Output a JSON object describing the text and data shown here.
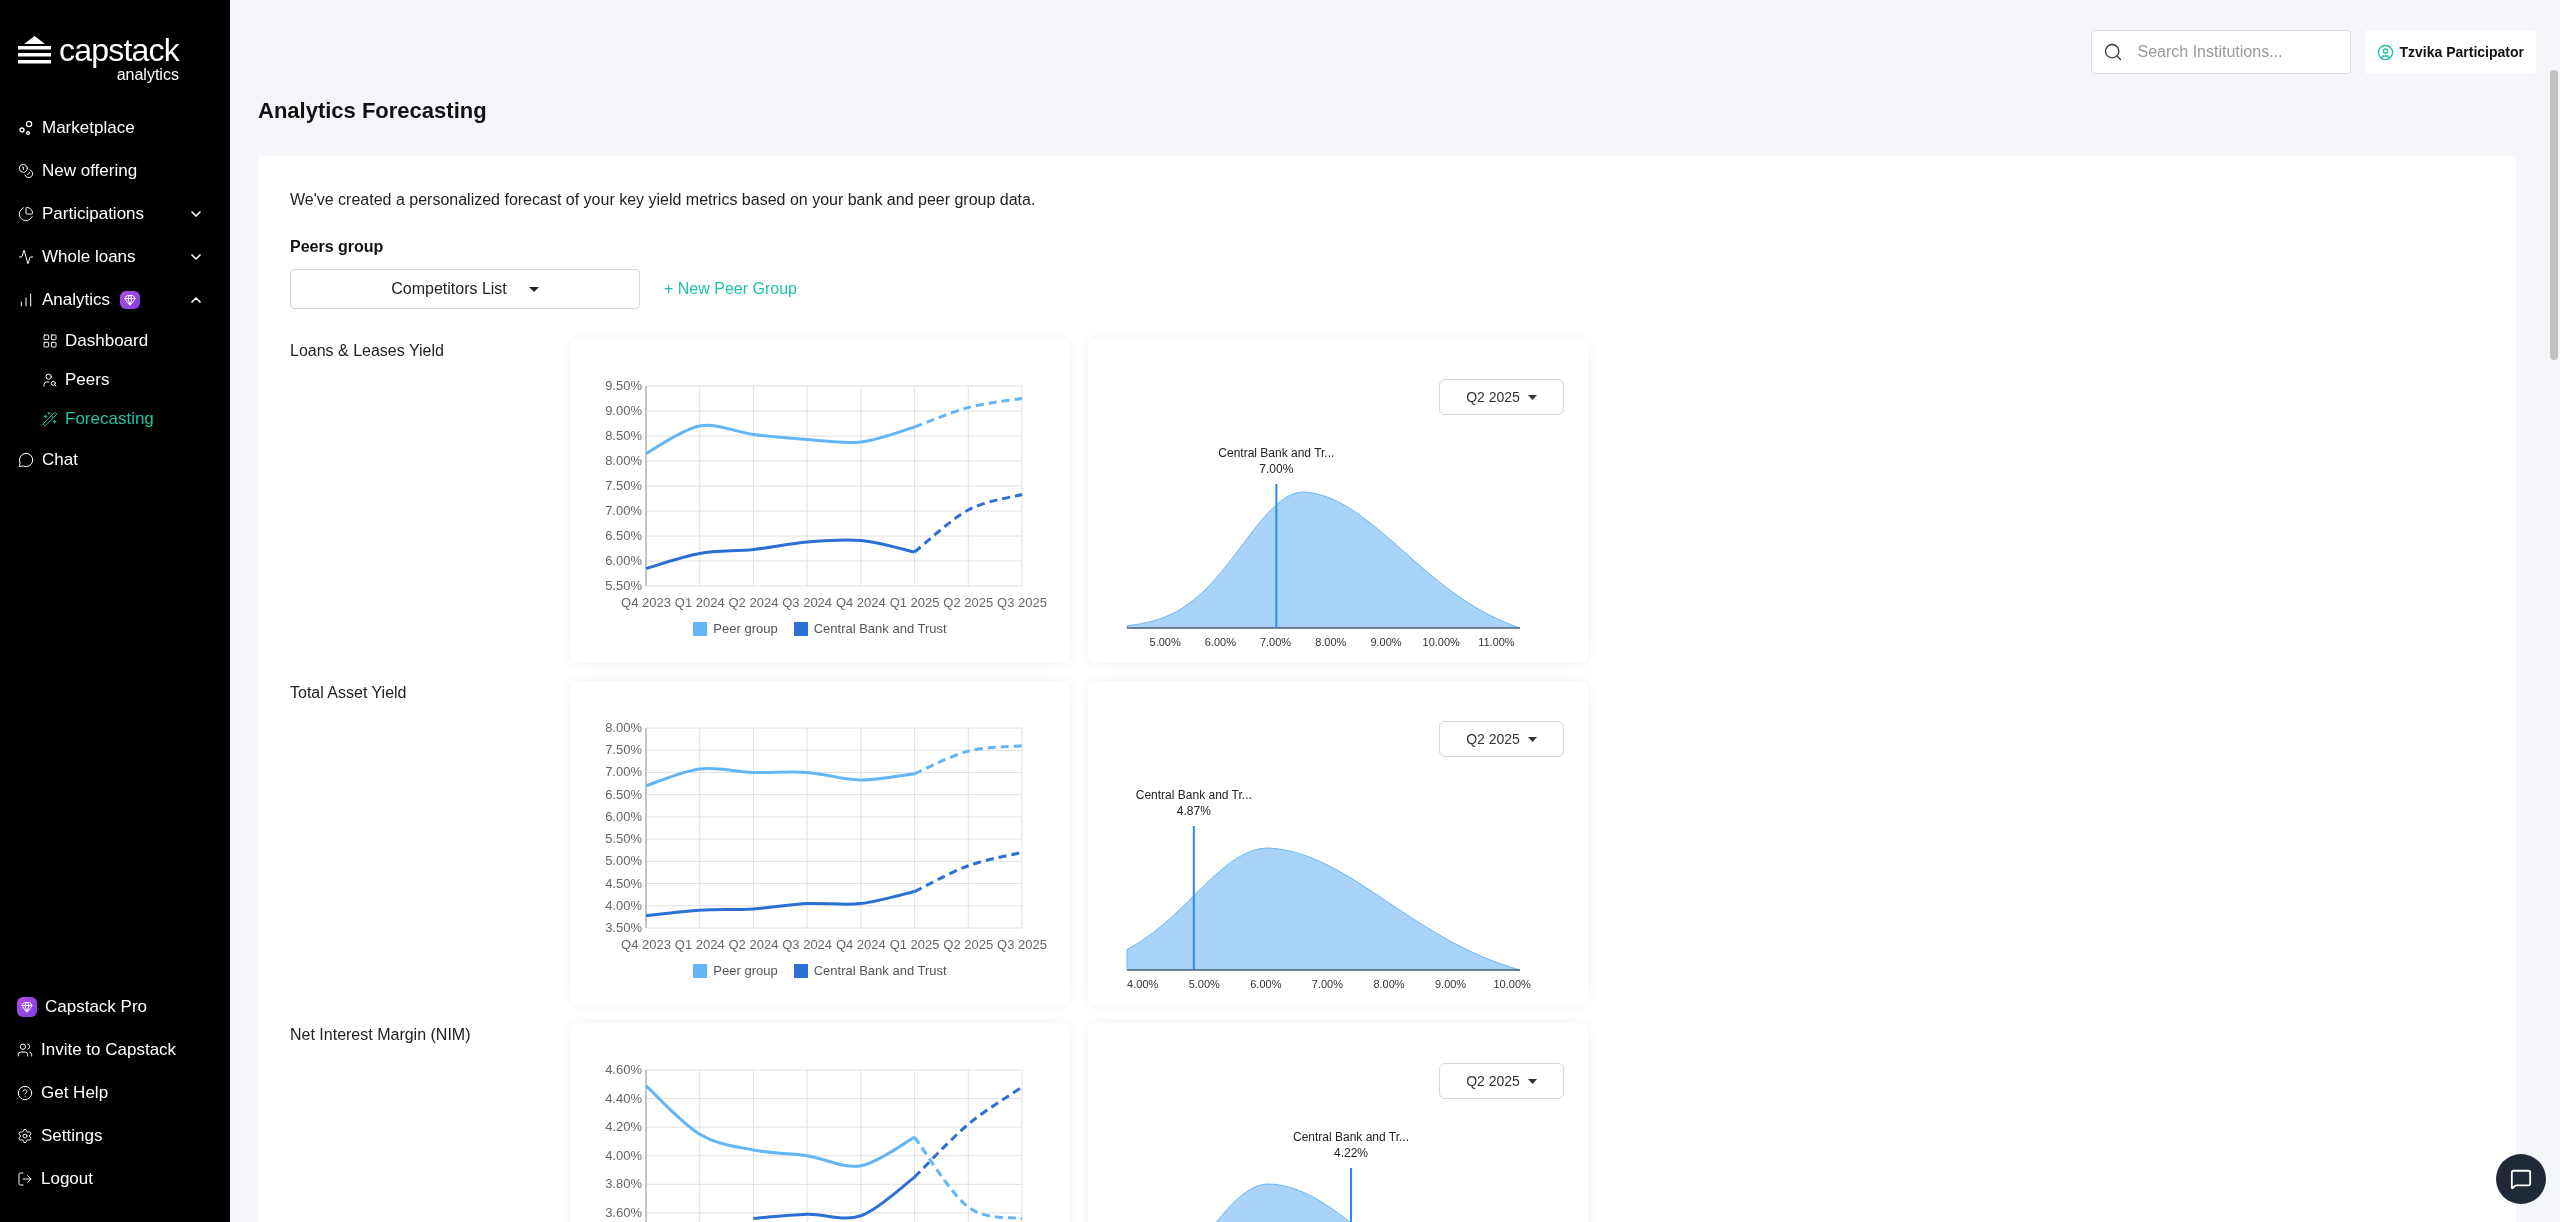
{
  "sidebar": {
    "logo": {
      "name": "capstack",
      "tagline": "analytics"
    },
    "items": [
      {
        "label": "Marketplace",
        "selected": false
      },
      {
        "label": "New offering",
        "selected": false
      },
      {
        "label": "Participations",
        "selected": false,
        "expanded": false
      },
      {
        "label": "Whole loans",
        "selected": false,
        "expanded": false
      },
      {
        "label": "Analytics",
        "selected": false,
        "expanded": true,
        "pro_badge": true,
        "children": [
          {
            "label": "Dashboard",
            "selected": false
          },
          {
            "label": "Peers",
            "selected": false
          },
          {
            "label": "Forecasting",
            "selected": true
          }
        ]
      },
      {
        "label": "Chat",
        "selected": false
      }
    ],
    "bottom_items": [
      {
        "label": "Capstack Pro",
        "kind": "pro"
      },
      {
        "label": "Invite to Capstack",
        "kind": "link"
      },
      {
        "label": "Get Help",
        "kind": "link"
      },
      {
        "label": "Settings",
        "kind": "link"
      },
      {
        "label": "Logout",
        "kind": "link"
      }
    ]
  },
  "topbar": {
    "search": {
      "placeholder": "Search Institutions..."
    },
    "user": {
      "name": "Tzvika Participator"
    }
  },
  "page": {
    "title": "Analytics Forecasting",
    "intro": "We've created a personalized forecast of your key yield metrics based on your bank and peer group data.",
    "peers_group": {
      "label": "Peers group",
      "select": {
        "value": "Competitors List"
      },
      "new_link": "+ New Peer Group"
    }
  },
  "metrics": [
    {
      "title": "Loans & Leases Yield",
      "trend": {
        "chart_data": {
          "type": "line",
          "categories": [
            "Q4 2023",
            "Q1 2024",
            "Q2 2024",
            "Q3 2024",
            "Q4 2024",
            "Q1 2025",
            "Q2 2025",
            "Q3 2025"
          ],
          "ylim": [
            5.5,
            9.5
          ],
          "yticks": [
            {
              "value": 5.5,
              "label": "5.50%"
            },
            {
              "value": 6,
              "label": "6.00%"
            },
            {
              "value": 6.5,
              "label": "6.50%"
            },
            {
              "value": 7,
              "label": "7.00%"
            },
            {
              "value": 7.5,
              "label": "7.50%"
            },
            {
              "value": 8,
              "label": "8.00%"
            },
            {
              "value": 8.5,
              "label": "8.50%"
            },
            {
              "value": 9,
              "label": "9.00%"
            },
            {
              "value": 9.5,
              "label": "9.50%"
            }
          ],
          "grid": true,
          "legend": "bottom",
          "series": [
            {
              "name": "Peer group",
              "color": "#64b5f6",
              "values": [
                8.15,
                8.7,
                8.53,
                8.43,
                8.38,
                8.68,
                null,
                null
              ]
            },
            {
              "name": "Central Bank and Trust",
              "color": "#2a70d4",
              "values": [
                5.85,
                6.15,
                6.23,
                6.38,
                6.41,
                6.18,
                null,
                null
              ]
            },
            {
              "color": "#64b5f6",
              "line_style": "dashed",
              "values": [
                null,
                null,
                null,
                null,
                null,
                8.68,
                9.07,
                9.25
              ]
            },
            {
              "color": "#2a70d4",
              "line_style": "dashed",
              "values": [
                null,
                null,
                null,
                null,
                null,
                6.18,
                7.02,
                7.33
              ]
            }
          ]
        }
      },
      "distribution": {
        "period": "Q2 2025",
        "marker_label": "Central Bank and Tr...",
        "marker_value": "7.00%",
        "x_axis_labels": [
          "5.00%",
          "6.00%",
          "7.00%",
          "8.00%",
          "9.00%",
          "10.00%",
          "11.00%"
        ]
      }
    },
    {
      "title": "Total Asset Yield",
      "trend": {
        "chart_data": {
          "type": "line",
          "categories": [
            "Q4 2023",
            "Q1 2024",
            "Q2 2024",
            "Q3 2024",
            "Q4 2024",
            "Q1 2025",
            "Q2 2025",
            "Q3 2025"
          ],
          "ylim": [
            3.5,
            8
          ],
          "yticks": [
            {
              "value": 3.5,
              "label": "3.50%"
            },
            {
              "value": 4,
              "label": "4.00%"
            },
            {
              "value": 4.5,
              "label": "4.50%"
            },
            {
              "value": 5,
              "label": "5.00%"
            },
            {
              "value": 5.5,
              "label": "5.50%"
            },
            {
              "value": 6,
              "label": "6.00%"
            },
            {
              "value": 6.5,
              "label": "6.50%"
            },
            {
              "value": 7,
              "label": "7.00%"
            },
            {
              "value": 7.5,
              "label": "7.50%"
            },
            {
              "value": 8,
              "label": "8.00%"
            }
          ],
          "grid": true,
          "legend": "bottom",
          "series": [
            {
              "name": "Peer group",
              "color": "#64b5f6",
              "values": [
                6.7,
                7.08,
                7.0,
                7.0,
                6.83,
                6.97,
                null,
                null
              ]
            },
            {
              "name": "Central Bank and Trust",
              "color": "#2a70d4",
              "values": [
                3.78,
                3.9,
                3.93,
                4.05,
                4.05,
                4.32,
                null,
                null
              ]
            },
            {
              "color": "#64b5f6",
              "line_style": "dashed",
              "values": [
                null,
                null,
                null,
                null,
                null,
                6.97,
                7.48,
                7.6
              ]
            },
            {
              "color": "#2a70d4",
              "line_style": "dashed",
              "values": [
                null,
                null,
                null,
                null,
                null,
                4.32,
                4.9,
                5.2
              ]
            }
          ]
        }
      },
      "distribution": {
        "period": "Q2 2025",
        "marker_label": "Central Bank and Tr...",
        "marker_value": "4.87%",
        "x_axis_labels": [
          "4.00%",
          "5.00%",
          "6.00%",
          "7.00%",
          "8.00%",
          "9.00%",
          "10.00%"
        ]
      }
    },
    {
      "title": "Net Interest Margin (NIM)",
      "trend": {
        "chart_data": {
          "type": "line",
          "ylim": [
            3.2,
            4.6
          ],
          "yticks": [
            {
              "value": 3.6,
              "label": "3.60%"
            },
            {
              "value": 3.8,
              "label": "3.80%"
            },
            {
              "value": 4,
              "label": "4.00%"
            },
            {
              "value": 4.2,
              "label": "4.20%"
            },
            {
              "value": 4.4,
              "label": "4.40%"
            },
            {
              "value": 4.6,
              "label": "4.60%"
            }
          ],
          "grid": true,
          "series": [
            {
              "color": "#64b5f6",
              "values": [
                4.49,
                4.15,
                4.04,
                4.0,
                3.93,
                4.13,
                null,
                null
              ]
            },
            {
              "color": "#2a70d4",
              "values": [
                null,
                null,
                3.56,
                3.59,
                3.58,
                3.85,
                null,
                null
              ]
            },
            {
              "color": "#64b5f6",
              "line_style": "dashed",
              "values": [
                null,
                null,
                null,
                null,
                null,
                4.13,
                3.64,
                3.56
              ]
            },
            {
              "color": "#2a70d4",
              "line_style": "dashed",
              "values": [
                null,
                null,
                null,
                null,
                null,
                3.85,
                4.22,
                4.48
              ]
            }
          ]
        }
      },
      "distribution": {
        "period": "Q2 2025",
        "marker_label": "Central Bank and Tr...",
        "marker_value": "4.22%"
      }
    }
  ]
}
